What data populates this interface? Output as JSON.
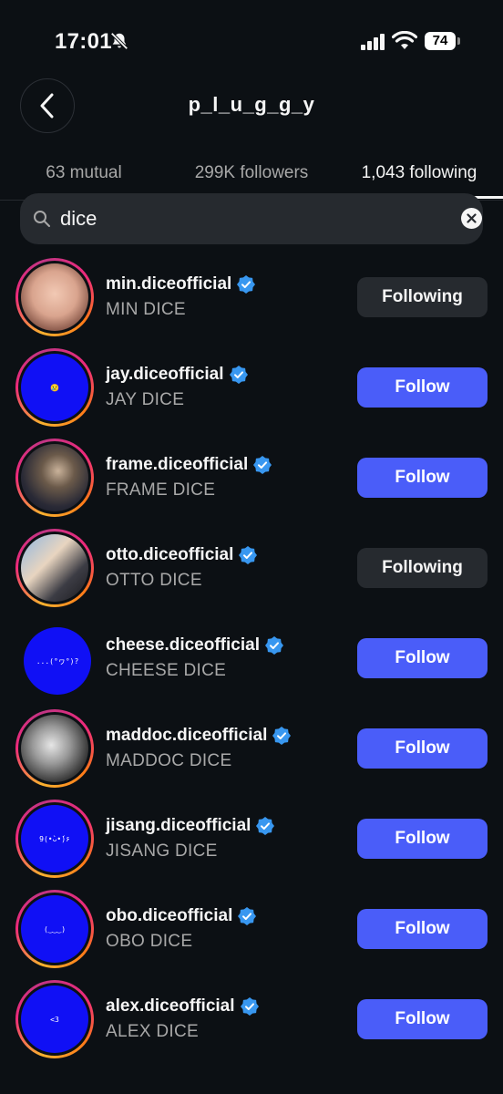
{
  "status_bar": {
    "time": "17:01",
    "battery": "74"
  },
  "header": {
    "title": "p_l_u_g_g_y"
  },
  "tabs": [
    {
      "label": "63 mutual",
      "active": false
    },
    {
      "label": "299K followers",
      "active": false
    },
    {
      "label": "1,043 following",
      "active": true
    }
  ],
  "search": {
    "value": "dice"
  },
  "colors": {
    "background": "#0c1014",
    "follow_button": "#4a5df9",
    "following_button": "#262a2f",
    "verified_badge": "#3897f0",
    "avatar_blue": "#1010f5"
  },
  "users": [
    {
      "username": "min.diceofficial",
      "full_name": "MIN DICE",
      "button": "Following",
      "state": "following",
      "story_ring": true,
      "avatar_text": "",
      "avatar_kind": "photo-face"
    },
    {
      "username": "jay.diceofficial",
      "full_name": "JAY DICE",
      "button": "Follow",
      "state": "follow",
      "story_ring": true,
      "avatar_text": "😢",
      "avatar_kind": "blue"
    },
    {
      "username": "frame.diceofficial",
      "full_name": "FRAME DICE",
      "button": "Follow",
      "state": "follow",
      "story_ring": true,
      "avatar_text": "",
      "avatar_kind": "photo-night"
    },
    {
      "username": "otto.diceofficial",
      "full_name": "OTTO DICE",
      "button": "Following",
      "state": "following",
      "story_ring": true,
      "avatar_text": "",
      "avatar_kind": "photo-car"
    },
    {
      "username": "cheese.diceofficial",
      "full_name": "CHEESE DICE",
      "button": "Follow",
      "state": "follow",
      "story_ring": false,
      "avatar_text": "...(°ヮ°)?",
      "avatar_kind": "blue"
    },
    {
      "username": "maddoc.diceofficial",
      "full_name": "MADDOC DICE",
      "button": "Follow",
      "state": "follow",
      "story_ring": true,
      "avatar_text": "",
      "avatar_kind": "photo-bw"
    },
    {
      "username": "jisang.diceofficial",
      "full_name": "JISANG DICE",
      "button": "Follow",
      "state": "follow",
      "story_ring": true,
      "avatar_text": "9(•̀ᴗ•́)۶",
      "avatar_kind": "blue"
    },
    {
      "username": "obo.diceofficial",
      "full_name": "OBO DICE",
      "button": "Follow",
      "state": "follow",
      "story_ring": true,
      "avatar_text": "(‿‿‿)",
      "avatar_kind": "blue"
    },
    {
      "username": "alex.diceofficial",
      "full_name": "ALEX DICE",
      "button": "Follow",
      "state": "follow",
      "story_ring": true,
      "avatar_text": "<3",
      "avatar_kind": "blue"
    }
  ]
}
